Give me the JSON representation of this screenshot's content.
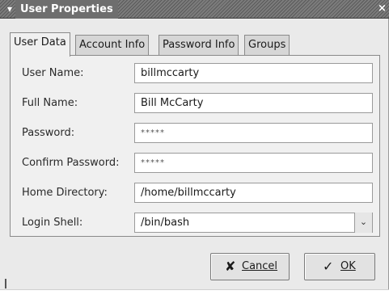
{
  "window": {
    "title": "User Properties",
    "menu_glyph": "▾",
    "close_glyph": "×"
  },
  "tabs": [
    {
      "label": "User Data",
      "active": true
    },
    {
      "label": "Account Info",
      "active": false
    },
    {
      "label": "Password Info",
      "active": false
    },
    {
      "label": "Groups",
      "active": false
    }
  ],
  "form": {
    "user_name": {
      "label": "User Name:",
      "value": "billmccarty"
    },
    "full_name": {
      "label": "Full Name:",
      "value": "Bill McCarty"
    },
    "password": {
      "label": "Password:",
      "value": "*****"
    },
    "confirm_password": {
      "label": "Confirm Password:",
      "value": "*****"
    },
    "home_directory": {
      "label": "Home Directory:",
      "value": "/home/billmccarty"
    },
    "login_shell": {
      "label": "Login Shell:",
      "value": "/bin/bash",
      "arrow": "⌄"
    }
  },
  "buttons": {
    "cancel": {
      "icon": "✘",
      "label": "Cancel"
    },
    "ok": {
      "icon": "✓",
      "label": "OK"
    }
  },
  "icons": {
    "window_menu": "chevron-down-icon",
    "close": "close-icon",
    "cancel": "cancel-icon",
    "ok": "ok-icon"
  }
}
